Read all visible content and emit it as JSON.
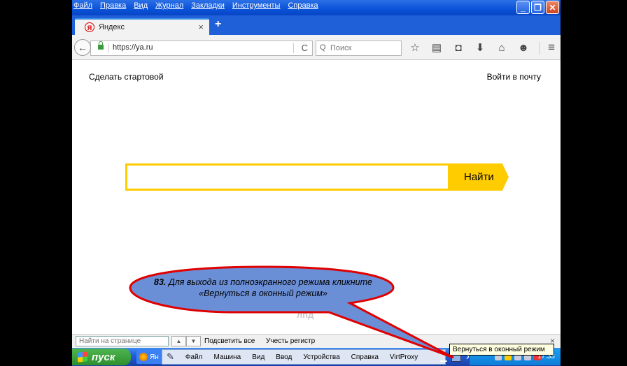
{
  "menubar": [
    "Файл",
    "Правка",
    "Вид",
    "Журнал",
    "Закладки",
    "Инструменты",
    "Справка"
  ],
  "window_buttons": [
    "_",
    "❐",
    "✕"
  ],
  "tab": {
    "favicon": "Я",
    "title": "Яндекс",
    "close": "×",
    "new_tab": "+"
  },
  "navbar": {
    "url": "https://ya.ru",
    "search_placeholder": "Поиск",
    "back_icon": "←",
    "reload_icon": "C",
    "search_icon": "Q",
    "icons": [
      "☆",
      "▤",
      "◘",
      "⬇",
      "⌂",
      "☻"
    ],
    "menu_icon": "≡"
  },
  "content": {
    "set_home": "Сделать стартовой",
    "mail_login": "Войти в почту",
    "search_button": "Найти",
    "logo_fragment": "лпд"
  },
  "findbar": {
    "placeholder": "Найти на странице",
    "up": "▲",
    "down": "▼",
    "highlight_all": "Подсветить все",
    "match_case": "Учесть регистр",
    "close": "×"
  },
  "taskbar": {
    "start": "пуск",
    "task": "Ян",
    "vbox_menu": [
      "Файл",
      "Машина",
      "Вид",
      "Ввод",
      "Устройства",
      "Справка",
      "VirtProxy"
    ],
    "tooltip": "Вернуться в оконный режим",
    "clock": "17:33"
  },
  "callout": {
    "step": "83.",
    "text_line1": "Для выхода из полноэкранного режима кликните",
    "text_line2": "«Вернуться в оконный режим»"
  },
  "colors": {
    "accent": "#ffcc00",
    "callout_fill": "#6b8fd6",
    "callout_stroke": "#e00000"
  }
}
